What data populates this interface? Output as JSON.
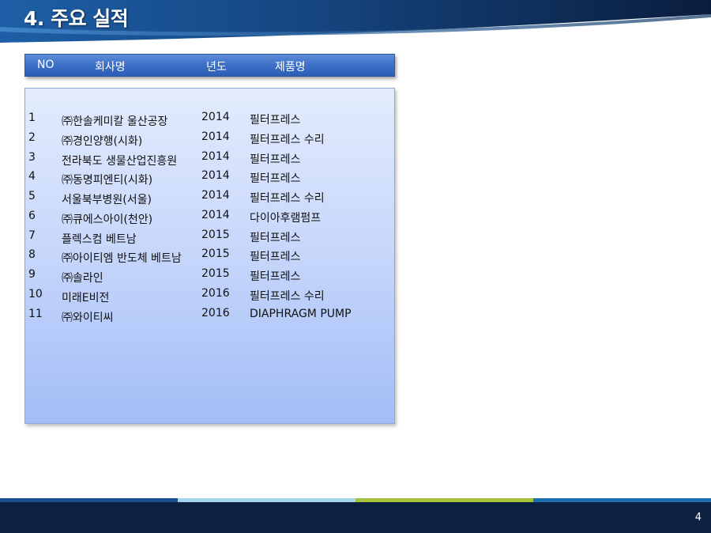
{
  "page": {
    "title": "4. 주요 실적",
    "page_number": "4"
  },
  "table": {
    "headers": {
      "no": "NO",
      "company": "회사명",
      "year": "년도",
      "product": "제품명"
    },
    "rows": [
      {
        "no": "1",
        "company": "㈜한솔케미칼 울산공장",
        "year": "2014",
        "product": "필터프레스"
      },
      {
        "no": "2",
        "company": "㈜경인양행(시화)",
        "year": "2014",
        "product": "필터프레스 수리"
      },
      {
        "no": "3",
        "company": "전라북도 생물산업진흥원",
        "year": "2014",
        "product": "필터프레스"
      },
      {
        "no": "4",
        "company": "㈜동명피엔티(시화)",
        "year": "2014",
        "product": "필터프레스"
      },
      {
        "no": "5",
        "company": "서울북부병원(서울)",
        "year": "2014",
        "product": "필터프레스 수리"
      },
      {
        "no": "6",
        "company": "㈜큐에스아이(천안)",
        "year": "2014",
        "product": "다이아후램펌프"
      },
      {
        "no": "7",
        "company": "플렉스컴 베트남",
        "year": "2015",
        "product": "필터프레스"
      },
      {
        "no": "8",
        "company": "㈜아이티엠 반도체 베트남",
        "year": "2015",
        "product": "필터프레스"
      },
      {
        "no": "9",
        "company": "㈜솔라인",
        "year": "2015",
        "product": "필터프레스"
      },
      {
        "no": "10",
        "company": "미래E비전",
        "year": "2016",
        "product": "필터프레스 수리"
      },
      {
        "no": "11",
        "company": "㈜와이티씨",
        "year": "2016",
        "product": "DIAPHRAGM PUMP"
      }
    ]
  },
  "colors": {
    "header_dark": "#0c2248",
    "header_blue": "#1d5fa6",
    "column_header": "#3f72c8",
    "footer_bar": "#0c2040",
    "stripe": [
      "#1d4f8f",
      "#a9d6ef",
      "#a5c23a",
      "#1d6fb0"
    ]
  }
}
